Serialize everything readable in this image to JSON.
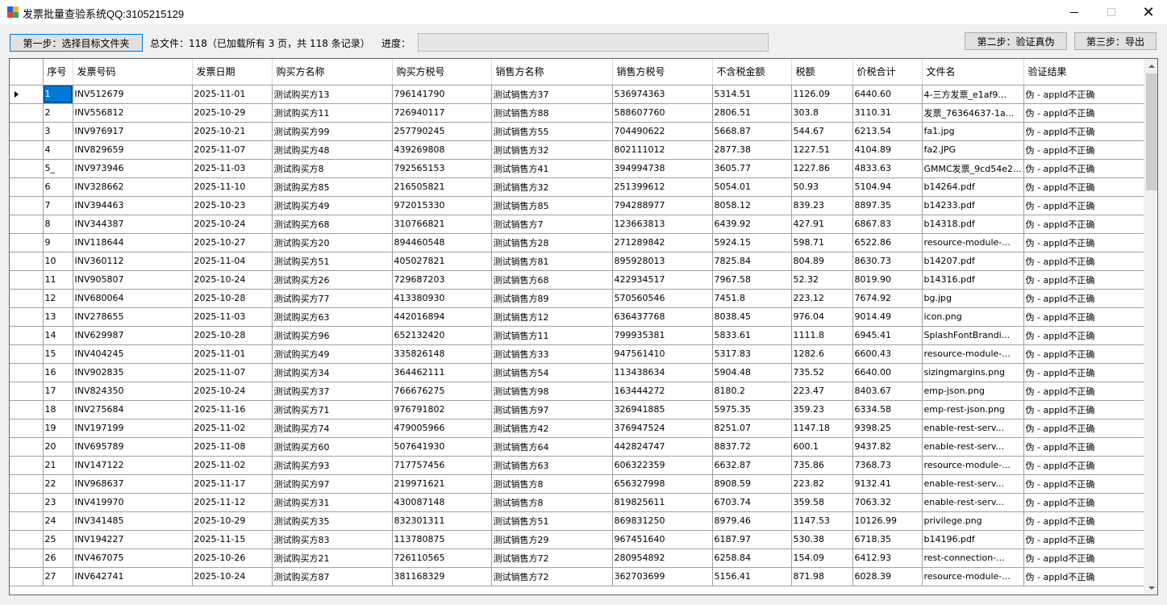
{
  "window": {
    "title": "发票批量查验系统QQ:3105215129",
    "minimize": "—",
    "maximize": "☐",
    "close": "✕"
  },
  "toolbar": {
    "step1_label": "第一步：选择目标文件夹",
    "total_text": "总文件：118（已加载所有 3 页，共 118 条记录）",
    "progress_label": "进度：",
    "progress_value": 0,
    "step2_label": "第二步：验证真伪",
    "step3_label": "第三步：导出"
  },
  "table": {
    "columns": [
      "序号",
      "发票号码",
      "发票日期",
      "购买方名称",
      "购买方税号",
      "销售方名称",
      "销售方税号",
      "不含税金额",
      "税额",
      "价税合计",
      "文件名",
      "验证结果"
    ],
    "rows": [
      [
        "1",
        "INV512679",
        "2025-11-01",
        "测试购买方13",
        "796141790",
        "测试销售方37",
        "536974363",
        "5314.51",
        "1126.09",
        "6440.60",
        "4-三方发票_e1af9...",
        "伪 - appId不正确"
      ],
      [
        "2",
        "INV556812",
        "2025-10-29",
        "测试购买方11",
        "726940117",
        "测试销售方88",
        "588607760",
        "2806.51",
        "303.8",
        "3110.31",
        "发票_76364637-1a...",
        "伪 - appId不正确"
      ],
      [
        "3",
        "INV976917",
        "2025-10-21",
        "测试购买方99",
        "257790245",
        "测试销售方55",
        "704490622",
        "5668.87",
        "544.67",
        "6213.54",
        "fa1.jpg",
        "伪 - appId不正确"
      ],
      [
        "4",
        "INV829659",
        "2025-11-07",
        "测试购买方48",
        "439269808",
        "测试销售方32",
        "802111012",
        "2877.38",
        "1227.51",
        "4104.89",
        "fa2.JPG",
        "伪 - appId不正确"
      ],
      [
        "5_",
        "INV973946",
        "2025-11-03",
        "测试购买方8",
        "792565153",
        "测试销售方41",
        "394994738",
        "3605.77",
        "1227.86",
        "4833.63",
        "GMMC发票_9cd54e2...",
        "伪 - appId不正确"
      ],
      [
        "6",
        "INV328662",
        "2025-11-10",
        "测试购买方85",
        "216505821",
        "测试销售方32",
        "251399612",
        "5054.01",
        "50.93",
        "5104.94",
        "b14264.pdf",
        "伪 - appId不正确"
      ],
      [
        "7",
        "INV394463",
        "2025-10-23",
        "测试购买方49",
        "972015330",
        "测试销售方85",
        "794288977",
        "8058.12",
        "839.23",
        "8897.35",
        "b14233.pdf",
        "伪 - appId不正确"
      ],
      [
        "8",
        "INV344387",
        "2025-10-24",
        "测试购买方68",
        "310766821",
        "测试销售方7",
        "123663813",
        "6439.92",
        "427.91",
        "6867.83",
        "b14318.pdf",
        "伪 - appId不正确"
      ],
      [
        "9",
        "INV118644",
        "2025-10-27",
        "测试购买方20",
        "894460548",
        "测试销售方28",
        "271289842",
        "5924.15",
        "598.71",
        "6522.86",
        "resource-module-...",
        "伪 - appId不正确"
      ],
      [
        "10",
        "INV360112",
        "2025-11-04",
        "测试购买方51",
        "405027821",
        "测试销售方81",
        "895928013",
        "7825.84",
        "804.89",
        "8630.73",
        "b14207.pdf",
        "伪 - appId不正确"
      ],
      [
        "11",
        "INV905807",
        "2025-10-24",
        "测试购买方26",
        "729687203",
        "测试销售方68",
        "422934517",
        "7967.58",
        "52.32",
        "8019.90",
        "b14316.pdf",
        "伪 - appId不正确"
      ],
      [
        "12",
        "INV680064",
        "2025-10-28",
        "测试购买方77",
        "413380930",
        "测试销售方89",
        "570560546",
        "7451.8",
        "223.12",
        "7674.92",
        "bg.jpg",
        "伪 - appId不正确"
      ],
      [
        "13",
        "INV278655",
        "2025-11-03",
        "测试购买方63",
        "442016894",
        "测试销售方12",
        "636437768",
        "8038.45",
        "976.04",
        "9014.49",
        "icon.png",
        "伪 - appId不正确"
      ],
      [
        "14",
        "INV629987",
        "2025-10-28",
        "测试购买方96",
        "652132420",
        "测试销售方11",
        "799935381",
        "5833.61",
        "1111.8",
        "6945.41",
        "SplashFontBrandi...",
        "伪 - appId不正确"
      ],
      [
        "15",
        "INV404245",
        "2025-11-01",
        "测试购买方49",
        "335826148",
        "测试销售方33",
        "947561410",
        "5317.83",
        "1282.6",
        "6600.43",
        "resource-module-...",
        "伪 - appId不正确"
      ],
      [
        "16",
        "INV902835",
        "2025-11-07",
        "测试购买方34",
        "364462111",
        "测试销售方54",
        "113438634",
        "5904.48",
        "735.52",
        "6640.00",
        "sizingmargins.png",
        "伪 - appId不正确"
      ],
      [
        "17",
        "INV824350",
        "2025-10-24",
        "测试购买方37",
        "766676275",
        "测试销售方98",
        "163444272",
        "8180.2",
        "223.47",
        "8403.67",
        "emp-json.png",
        "伪 - appId不正确"
      ],
      [
        "18",
        "INV275684",
        "2025-11-16",
        "测试购买方71",
        "976791802",
        "测试销售方97",
        "326941885",
        "5975.35",
        "359.23",
        "6334.58",
        "emp-rest-json.png",
        "伪 - appId不正确"
      ],
      [
        "19",
        "INV197199",
        "2025-11-02",
        "测试购买方74",
        "479005966",
        "测试销售方42",
        "376947524",
        "8251.07",
        "1147.18",
        "9398.25",
        "enable-rest-serv...",
        "伪 - appId不正确"
      ],
      [
        "20",
        "INV695789",
        "2025-11-08",
        "测试购买方60",
        "507641930",
        "测试销售方64",
        "442824747",
        "8837.72",
        "600.1",
        "9437.82",
        "enable-rest-serv...",
        "伪 - appId不正确"
      ],
      [
        "21",
        "INV147122",
        "2025-11-02",
        "测试购买方93",
        "717757456",
        "测试销售方63",
        "606322359",
        "6632.87",
        "735.86",
        "7368.73",
        "resource-module-...",
        "伪 - appId不正确"
      ],
      [
        "22",
        "INV968637",
        "2025-11-17",
        "测试购买方97",
        "219971621",
        "测试销售方8",
        "656327998",
        "8908.59",
        "223.82",
        "9132.41",
        "enable-rest-serv...",
        "伪 - appId不正确"
      ],
      [
        "23",
        "INV419970",
        "2025-11-12",
        "测试购买方31",
        "430087148",
        "测试销售方8",
        "819825611",
        "6703.74",
        "359.58",
        "7063.32",
        "enable-rest-serv...",
        "伪 - appId不正确"
      ],
      [
        "24",
        "INV341485",
        "2025-10-29",
        "测试购买方35",
        "832301311",
        "测试销售方51",
        "869831250",
        "8979.46",
        "1147.53",
        "10126.99",
        "privilege.png",
        "伪 - appId不正确"
      ],
      [
        "25",
        "INV194227",
        "2025-11-15",
        "测试购买方83",
        "113780875",
        "测试销售方29",
        "967451640",
        "6187.97",
        "530.38",
        "6718.35",
        "b14196.pdf",
        "伪 - appId不正确"
      ],
      [
        "26",
        "INV467075",
        "2025-10-26",
        "测试购买方21",
        "726110565",
        "测试销售方72",
        "280954892",
        "6258.84",
        "154.09",
        "6412.93",
        "rest-connection-...",
        "伪 - appId不正确"
      ],
      [
        "27",
        "INV642741",
        "2025-10-24",
        "测试购买方87",
        "381168329",
        "测试销售方72",
        "362703699",
        "5156.41",
        "871.98",
        "6028.39",
        "resource-module-...",
        "伪 - appId不正确"
      ]
    ]
  },
  "icons": {
    "app": "app-icon",
    "row_selector": "row-selector-arrow-icon",
    "scroll_up": "scroll-up-icon",
    "scroll_down": "scroll-down-icon"
  }
}
